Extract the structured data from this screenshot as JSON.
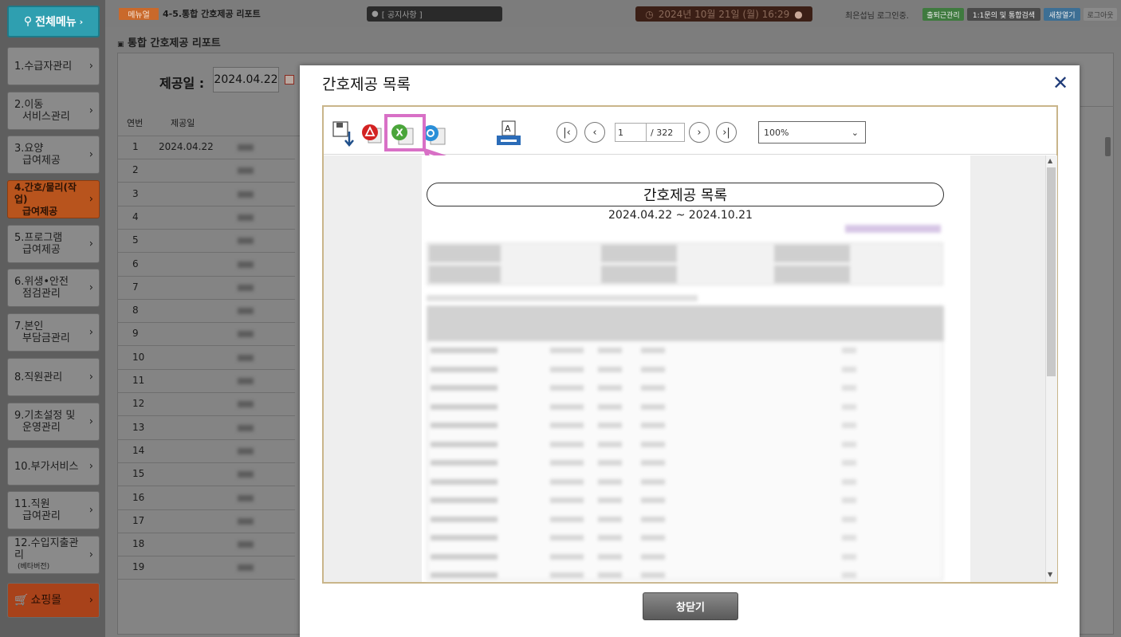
{
  "sidebar": {
    "menu_button": "전체메뉴",
    "items": [
      {
        "line1": "1.수급자관리",
        "line2": ""
      },
      {
        "line1": "2.이동",
        "line2": "서비스관리"
      },
      {
        "line1": "3.요양",
        "line2": "급여제공"
      },
      {
        "line1": "4.간호/물리(작업)",
        "line2": "급여제공"
      },
      {
        "line1": "5.프로그램",
        "line2": "급여제공"
      },
      {
        "line1": "6.위생•안전",
        "line2": "점검관리"
      },
      {
        "line1": "7.본인",
        "line2": "부담금관리"
      },
      {
        "line1": "8.직원관리",
        "line2": ""
      },
      {
        "line1": "9.기초설정 및",
        "line2": "운영관리"
      },
      {
        "line1": "10.부가서비스",
        "line2": ""
      },
      {
        "line1": "11.직원",
        "line2": "급여관리"
      },
      {
        "line1": "12.수입지출관리",
        "line2": "(베타버전)"
      }
    ],
    "shop_label": "쇼핑몰"
  },
  "topbar": {
    "badge": "메뉴얼",
    "breadcrumb": "4-5.통합 간호제공 리포트",
    "notice": "[ 공지사항 ]",
    "datetime": "2024년 10월 21일 (월) 16:29",
    "login_text": "최은섭님 로그인중.",
    "buttons": [
      "출퇴근관리",
      "1:1문의 및 통합검색",
      "새창열기",
      "로그아웃"
    ]
  },
  "main": {
    "report_title": "통합 간호제공 리포트",
    "date_label": "제공일 :",
    "date_value": "2024.04.22",
    "table_headers": [
      "연번",
      "제공일"
    ],
    "first_row_date": "2024.04.22",
    "row_numbers": [
      "1",
      "2",
      "3",
      "4",
      "5",
      "6",
      "7",
      "8",
      "9",
      "10",
      "11",
      "12",
      "13",
      "14",
      "15",
      "16",
      "17",
      "18",
      "19"
    ]
  },
  "modal": {
    "title": "간호제공 목록",
    "close_icon": "close-icon",
    "toolbar": {
      "page_current": "1",
      "page_total": "/ 322",
      "zoom": "100%"
    },
    "document": {
      "title": "간호제공 목록",
      "range": "2024.04.22 ~ 2024.10.21"
    },
    "close_button": "창닫기"
  },
  "colors": {
    "highlight": "#d870c6",
    "active_menu": "#b8541d",
    "menu_button": "#2f9fb0"
  }
}
